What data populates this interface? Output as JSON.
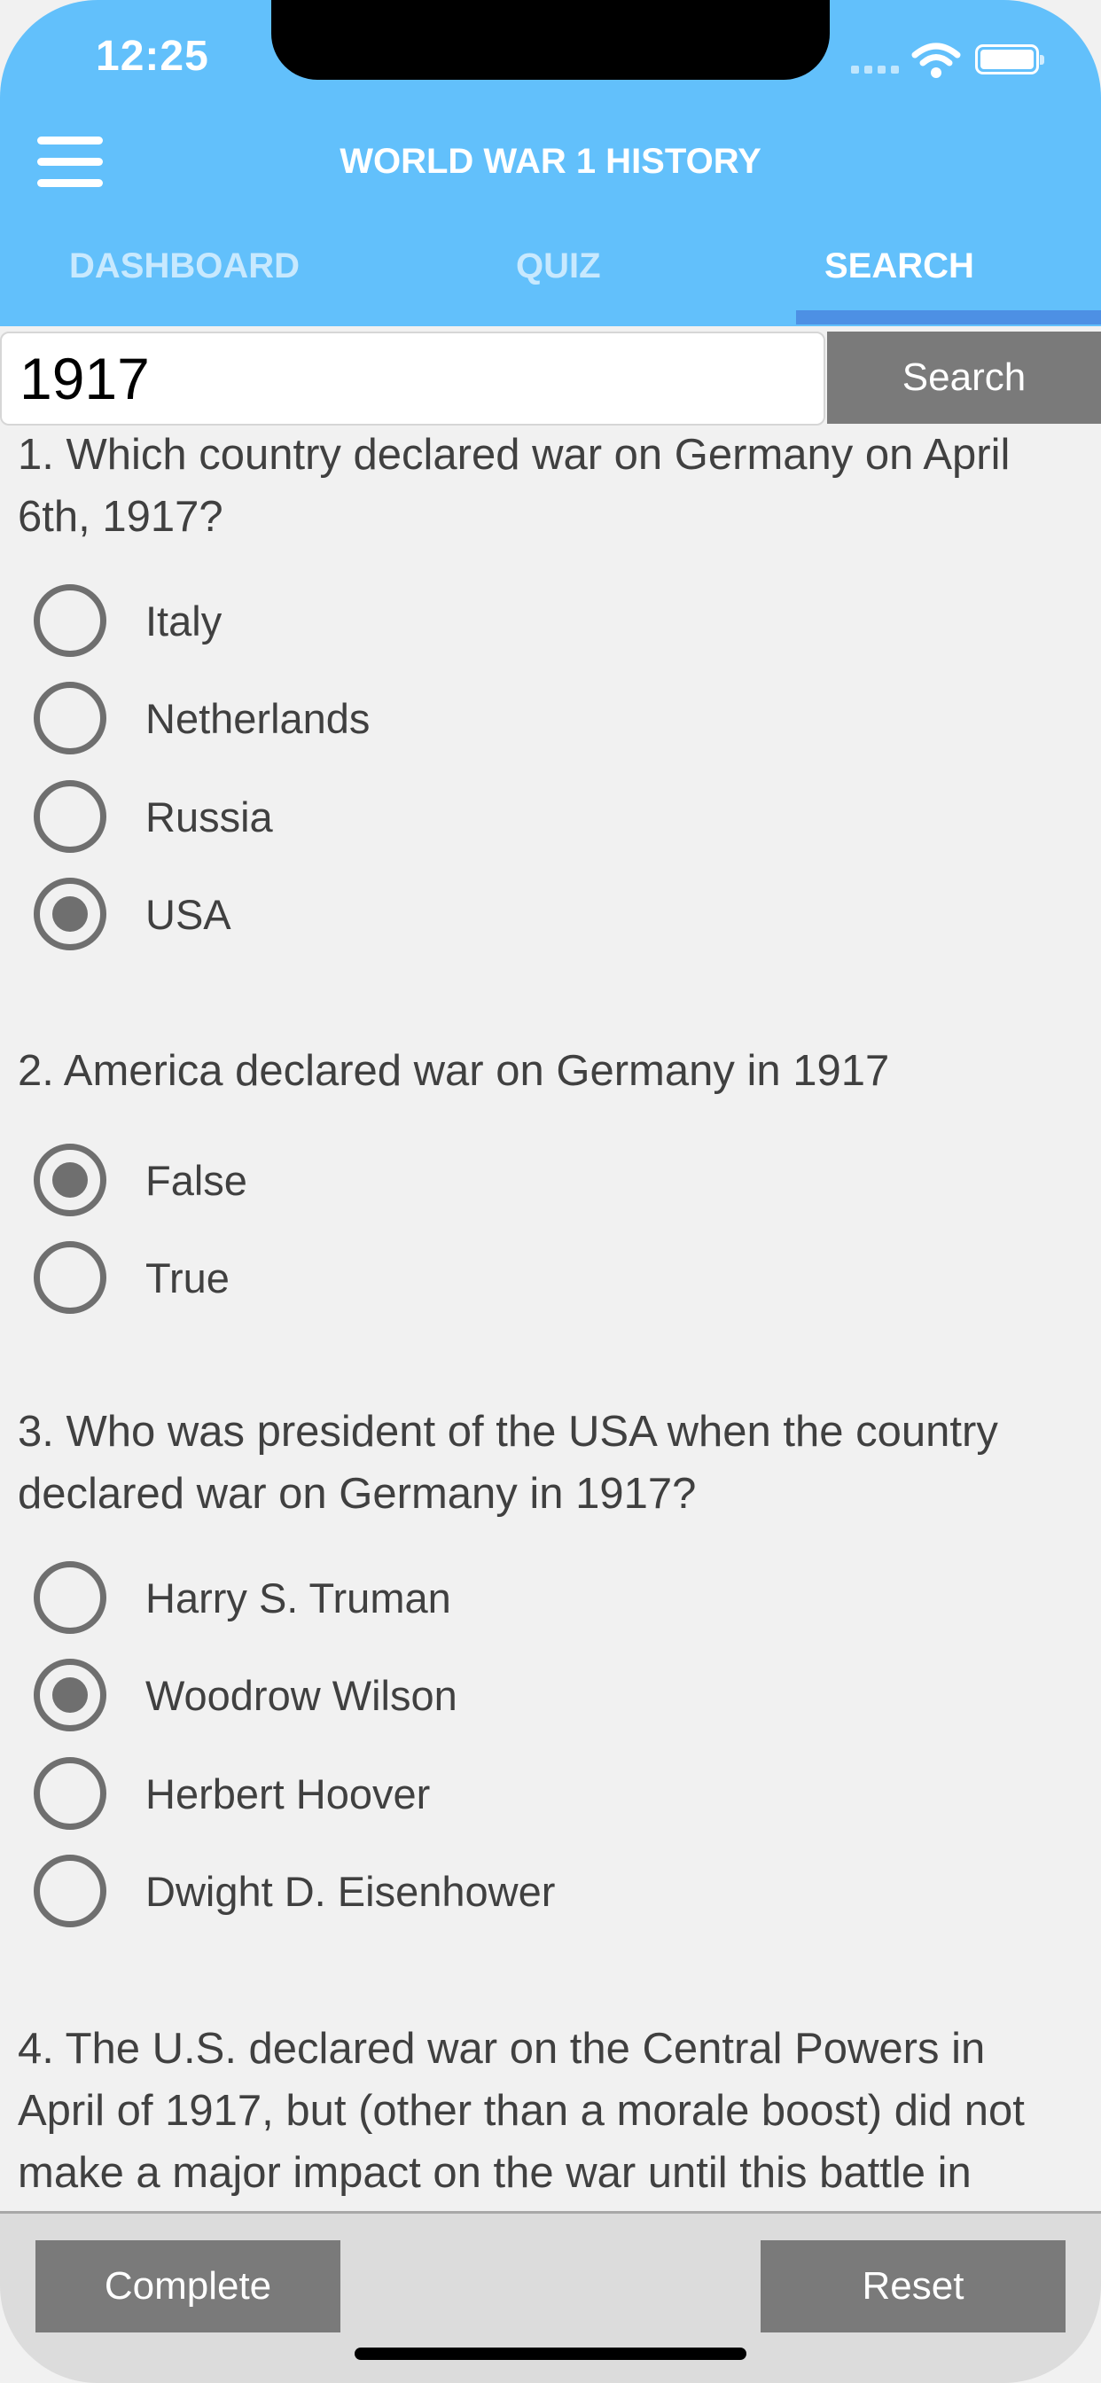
{
  "status_bar": {
    "time": "12:25"
  },
  "header": {
    "title": "WORLD WAR 1 HISTORY",
    "menu_icon": "hamburger-menu-icon"
  },
  "tabs": [
    {
      "label": "DASHBOARD",
      "active": false
    },
    {
      "label": "QUIZ",
      "active": false
    },
    {
      "label": "SEARCH",
      "active": true
    }
  ],
  "search": {
    "value": "1917",
    "button_label": "Search"
  },
  "questions": [
    {
      "text": "1. Which country declared war on Germany on April 6th, 1917?",
      "options": [
        {
          "label": "Italy",
          "selected": false
        },
        {
          "label": "Netherlands",
          "selected": false
        },
        {
          "label": "Russia",
          "selected": false
        },
        {
          "label": "USA",
          "selected": true
        }
      ]
    },
    {
      "text": "2. America declared war on Germany in 1917",
      "options": [
        {
          "label": "False",
          "selected": true
        },
        {
          "label": "True",
          "selected": false
        }
      ]
    },
    {
      "text": "3. Who was president of the USA when the country declared war on Germany in 1917?",
      "options": [
        {
          "label": "Harry S. Truman",
          "selected": false
        },
        {
          "label": "Woodrow Wilson",
          "selected": true
        },
        {
          "label": "Herbert Hoover",
          "selected": false
        },
        {
          "label": "Dwight D. Eisenhower",
          "selected": false
        }
      ]
    },
    {
      "text": "4. The U.S. declared war on the Central Powers in April of 1917, but (other than a morale boost) did not make a major impact on the war until this battle in",
      "options": []
    }
  ],
  "bottom_bar": {
    "complete_label": "Complete",
    "reset_label": "Reset"
  }
}
